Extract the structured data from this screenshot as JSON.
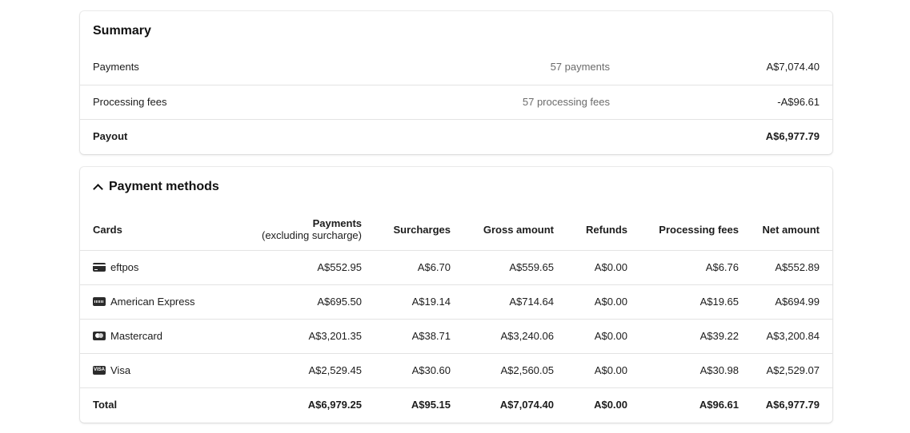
{
  "summary": {
    "title": "Summary",
    "rows": [
      {
        "label": "Payments",
        "count": "57 payments",
        "amount": "A$7,074.40"
      },
      {
        "label": "Processing fees",
        "count": "57 processing fees",
        "amount": "-A$96.61"
      },
      {
        "label": "Payout",
        "count": "",
        "amount": "A$6,977.79"
      }
    ]
  },
  "payment_methods": {
    "title": "Payment methods",
    "toggle_icon": "chevron-up-icon",
    "columns": {
      "cards": "Cards",
      "payments": "Payments",
      "payments_sub": "(excluding surcharge)",
      "surcharges": "Surcharges",
      "gross": "Gross amount",
      "refunds": "Refunds",
      "fees": "Processing fees",
      "net": "Net amount"
    },
    "rows": [
      {
        "icon": "eftpos-card-icon",
        "name": "eftpos",
        "payments": "A$552.95",
        "surcharges": "A$6.70",
        "gross": "A$559.65",
        "refunds": "A$0.00",
        "fees": "A$6.76",
        "net": "A$552.89"
      },
      {
        "icon": "amex-card-icon",
        "name": "American Express",
        "payments": "A$695.50",
        "surcharges": "A$19.14",
        "gross": "A$714.64",
        "refunds": "A$0.00",
        "fees": "A$19.65",
        "net": "A$694.99"
      },
      {
        "icon": "mastercard-card-icon",
        "name": "Mastercard",
        "payments": "A$3,201.35",
        "surcharges": "A$38.71",
        "gross": "A$3,240.06",
        "refunds": "A$0.00",
        "fees": "A$39.22",
        "net": "A$3,200.84"
      },
      {
        "icon": "visa-card-icon",
        "name": "Visa",
        "payments": "A$2,529.45",
        "surcharges": "A$30.60",
        "gross": "A$2,560.05",
        "refunds": "A$0.00",
        "fees": "A$30.98",
        "net": "A$2,529.07"
      }
    ],
    "total": {
      "name": "Total",
      "payments": "A$6,979.25",
      "surcharges": "A$95.15",
      "gross": "A$7,074.40",
      "refunds": "A$0.00",
      "fees": "A$96.61",
      "net": "A$6,977.79"
    }
  }
}
